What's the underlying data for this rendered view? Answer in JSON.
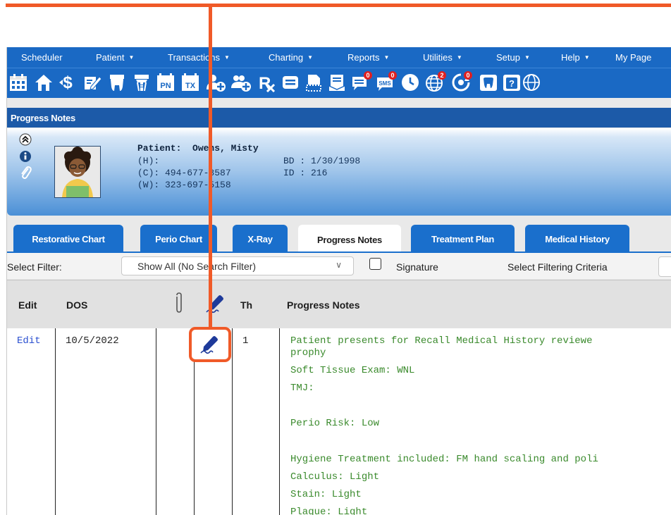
{
  "menu": {
    "items": [
      {
        "label": "Scheduler",
        "dropdown": false
      },
      {
        "label": "Patient",
        "dropdown": true
      },
      {
        "label": "Transactions",
        "dropdown": true
      },
      {
        "label": "Charting",
        "dropdown": true
      },
      {
        "label": "Reports",
        "dropdown": true
      },
      {
        "label": "Utilities",
        "dropdown": true
      },
      {
        "label": "Setup",
        "dropdown": true
      },
      {
        "label": "Help",
        "dropdown": true
      },
      {
        "label": "My Page",
        "dropdown": false
      }
    ]
  },
  "toolbar": {
    "icons": [
      "calendar-icon",
      "home-icon",
      "ledger-dollar-icon",
      "tx-notes-icon",
      "tooth-icon",
      "tooth-implant-icon",
      "pn-icon",
      "tx-icon",
      "add-patient-icon",
      "add-family-icon",
      "rx-icon",
      "messages-icon",
      "documents-icon",
      "forms-icon",
      "chat-icon",
      "sms-icon",
      "clock-icon",
      "globe-icon",
      "recall-icon",
      "tooth-chart-icon",
      "help-question-icon",
      "web-icon"
    ],
    "pn_label": "PN",
    "tx_label": "TX",
    "sms_label": "SMS",
    "chat_badge": "0",
    "sms_badge": "0",
    "globe_badge": "2",
    "recall_badge": "0"
  },
  "section_title": "Progress Notes",
  "patient": {
    "name_label": "Patient:",
    "name": "Owens, Misty",
    "home_phone": "(H):",
    "cell_phone": "(C):  494-677-8587",
    "work_phone": "(W): 323-697-5158",
    "birthdate": "BD : 1/30/1998",
    "id": "ID : 216"
  },
  "tabs": [
    {
      "label": "Restorative Chart",
      "active": false
    },
    {
      "label": "Perio Chart",
      "active": false
    },
    {
      "label": "X-Ray",
      "active": false
    },
    {
      "label": "Progress Notes",
      "active": true
    },
    {
      "label": "Treatment Plan",
      "active": false
    },
    {
      "label": "Medical History",
      "active": false
    }
  ],
  "filter": {
    "label": "Select Filter:",
    "selected": "Show All (No Search Filter)",
    "signature_label": "Signature",
    "criteria_label": "Select Filtering Criteria"
  },
  "table": {
    "headers": {
      "edit": "Edit",
      "dos": "DOS",
      "th": "Th",
      "notes": "Progress Notes"
    },
    "rows": [
      {
        "edit": "Edit",
        "dos": "10/5/2022",
        "th": "1",
        "notes": [
          "Patient presents for Recall  Medical History reviewe",
          "prophy",
          "Soft Tissue Exam: WNL",
          "TMJ:",
          "",
          "Perio Risk: Low",
          "",
          "Hygiene Treatment included: FM hand scaling and poli",
          "Calculus: Light",
          "Stain: Light",
          "Plaque: Light"
        ]
      }
    ]
  },
  "colors": {
    "menu_blue": "#1a69c4",
    "section_blue": "#1c5aa8",
    "tab_blue": "#1a6fcc",
    "annotation_orange": "#f05a28",
    "note_green": "#3a8a2c"
  }
}
